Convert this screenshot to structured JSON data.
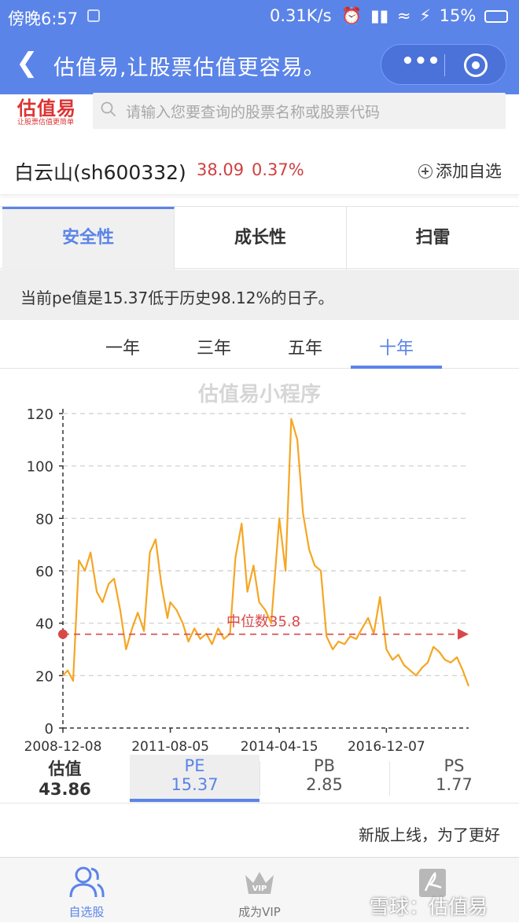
{
  "status_bar": {
    "time": "傍晚6:57",
    "network_speed": "0.31K/s",
    "battery": "15%"
  },
  "nav": {
    "title": "估值易,让股票估值更容易。"
  },
  "brand": {
    "logo_text": "估值易",
    "logo_sub": "让股票估值更简单"
  },
  "search": {
    "placeholder": "请输入您要查询的股票名称或股票代码"
  },
  "stock": {
    "name": "白云山(sh600332)",
    "price": "38.09",
    "change": "0.37%",
    "add_watchlist": "添加自选"
  },
  "tabs": [
    {
      "label": "安全性",
      "active": true
    },
    {
      "label": "成长性",
      "active": false
    },
    {
      "label": "扫雷",
      "active": false
    }
  ],
  "notice": "当前pe值是15.37低于历史98.12%的日子。",
  "periods": [
    {
      "label": "一年",
      "active": false
    },
    {
      "label": "三年",
      "active": false
    },
    {
      "label": "五年",
      "active": false
    },
    {
      "label": "十年",
      "active": true
    }
  ],
  "chart_data": {
    "type": "line",
    "title": "估值易小程序",
    "ylim": [
      0,
      120
    ],
    "yticks": [
      0,
      20,
      40,
      60,
      80,
      100,
      120
    ],
    "xticks": [
      "2008-12-08",
      "2011-08-05",
      "2014-04-15",
      "2016-12-07"
    ],
    "median_label": "中位数35.8",
    "median_value": 35.8,
    "colors": {
      "line": "#f5a623",
      "median": "#d94848",
      "grid": "#cccccc"
    },
    "series": [
      {
        "x": [
          "2008-12-08",
          "2009-01-20",
          "2009-03-10",
          "2009-05-01",
          "2009-06-25",
          "2009-08-15",
          "2009-10-10",
          "2009-12-01",
          "2010-01-25",
          "2010-03-15",
          "2010-05-10",
          "2010-07-01",
          "2010-08-25",
          "2010-10-15",
          "2010-12-10",
          "2011-02-01",
          "2011-03-25",
          "2011-05-15",
          "2011-07-10",
          "2011-08-05",
          "2011-10-01",
          "2011-11-25",
          "2012-01-15",
          "2012-03-10",
          "2012-05-01",
          "2012-06-25",
          "2012-08-15",
          "2012-10-10",
          "2012-12-01",
          "2013-01-25",
          "2013-03-15",
          "2013-05-10",
          "2013-07-01",
          "2013-08-25",
          "2013-10-15",
          "2013-12-10",
          "2014-02-01",
          "2014-04-15",
          "2014-06-10",
          "2014-08-01",
          "2014-09-25",
          "2014-11-15",
          "2015-01-10",
          "2015-03-01",
          "2015-04-25",
          "2015-06-15",
          "2015-08-10",
          "2015-10-01",
          "2015-11-25",
          "2016-01-15",
          "2016-03-10",
          "2016-05-01",
          "2016-06-25",
          "2016-08-15",
          "2016-10-10",
          "2016-12-07",
          "2017-02-01",
          "2017-03-25",
          "2017-05-15",
          "2017-07-10",
          "2017-09-01",
          "2017-10-25",
          "2017-12-15",
          "2018-02-05",
          "2018-03-30",
          "2018-05-20",
          "2018-07-12",
          "2018-09-05",
          "2018-10-28",
          "2018-12-20"
        ],
        "values": [
          20,
          22,
          18,
          64,
          60,
          67,
          52,
          48,
          55,
          57,
          45,
          30,
          38,
          44,
          37,
          67,
          72,
          55,
          42,
          48,
          45,
          40,
          33,
          38,
          34,
          36,
          32,
          38,
          34,
          36,
          65,
          78,
          52,
          62,
          48,
          45,
          40,
          80,
          60,
          118,
          110,
          82,
          68,
          62,
          60,
          35,
          30,
          33,
          32,
          35,
          34,
          38,
          42,
          36,
          50,
          30,
          26,
          28,
          24,
          22,
          20,
          23,
          25,
          31,
          29,
          26,
          25,
          27,
          22,
          16
        ]
      }
    ]
  },
  "metrics": [
    {
      "label": "估值",
      "value": "43.86",
      "active": false
    },
    {
      "label": "PE",
      "value": "15.37",
      "active": true
    },
    {
      "label": "PB",
      "value": "2.85",
      "active": false
    },
    {
      "label": "PS",
      "value": "1.77",
      "active": false
    }
  ],
  "marquee": "新版上线，为了更好",
  "tabbar": [
    {
      "label": "自选股",
      "icon": "users-icon",
      "active": true
    },
    {
      "label": "成为VIP",
      "icon": "crown-vip-icon",
      "active": false
    },
    {
      "label": "",
      "icon": "pdf-icon",
      "active": false
    }
  ],
  "watermark": "雪球：估值易"
}
